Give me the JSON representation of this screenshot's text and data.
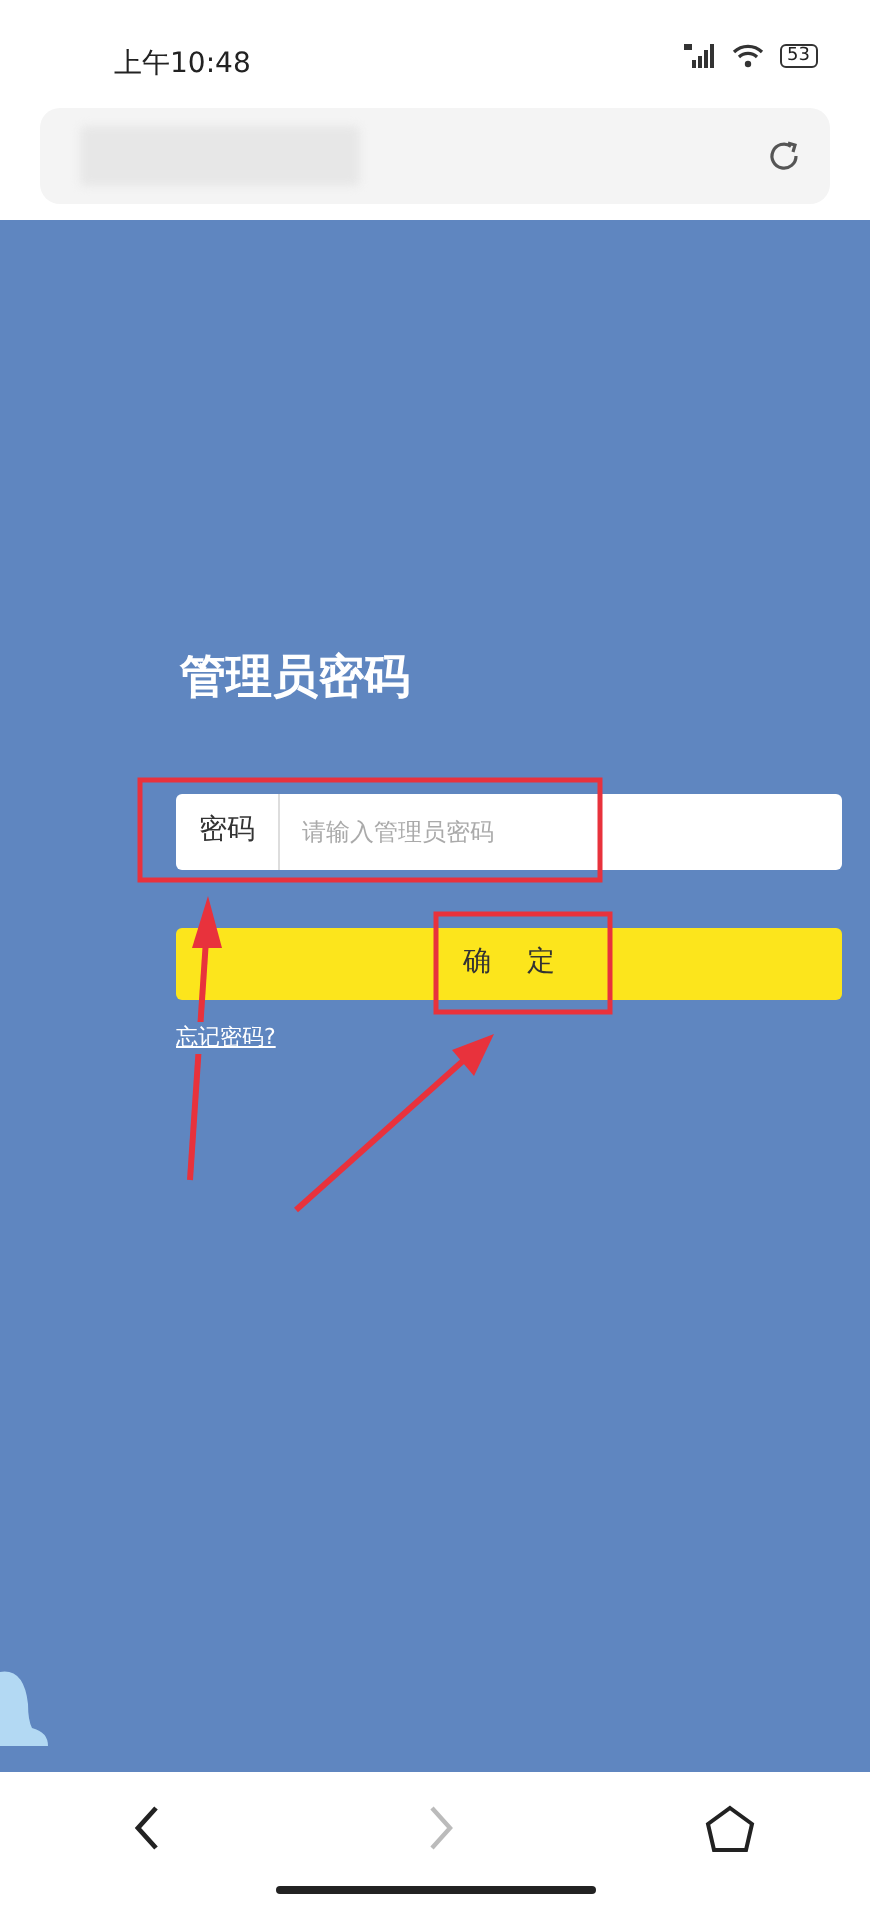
{
  "status_bar": {
    "time": "上午10:48",
    "battery": "53"
  },
  "page": {
    "title": "管理员密码",
    "password_field": {
      "label": "密码",
      "placeholder": "请输入管理员密码"
    },
    "confirm_button": "确 定",
    "forgot_link": "忘记密码?"
  },
  "nav_bar": [
    {
      "kind": "back",
      "disabled": false
    },
    {
      "kind": "forward",
      "disabled": true
    },
    {
      "kind": "home",
      "disabled": false
    }
  ]
}
